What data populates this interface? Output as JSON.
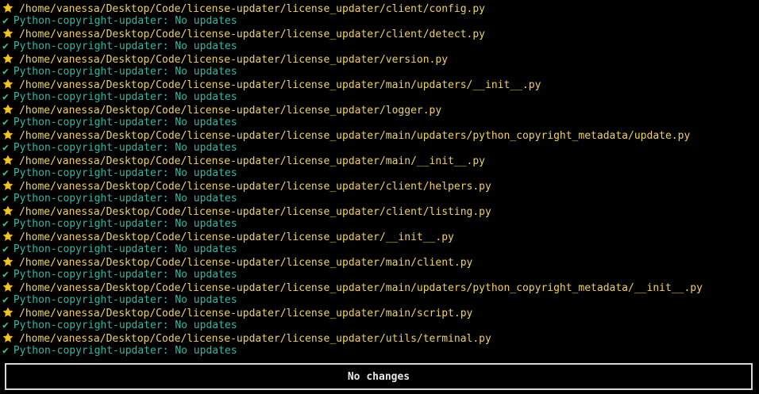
{
  "status_check_glyph": "✔",
  "entries": [
    {
      "path": "/home/vanessa/Desktop/Code/license-updater/license_updater/client/config.py",
      "status": "Python-copyright-updater: No updates"
    },
    {
      "path": "/home/vanessa/Desktop/Code/license-updater/license_updater/client/detect.py",
      "status": "Python-copyright-updater: No updates"
    },
    {
      "path": "/home/vanessa/Desktop/Code/license-updater/license_updater/version.py",
      "status": "Python-copyright-updater: No updates"
    },
    {
      "path": "/home/vanessa/Desktop/Code/license-updater/license_updater/main/updaters/__init__.py",
      "status": "Python-copyright-updater: No updates"
    },
    {
      "path": "/home/vanessa/Desktop/Code/license-updater/license_updater/logger.py",
      "status": "Python-copyright-updater: No updates"
    },
    {
      "path": "/home/vanessa/Desktop/Code/license-updater/license_updater/main/updaters/python_copyright_metadata/update.py",
      "status": "Python-copyright-updater: No updates"
    },
    {
      "path": "/home/vanessa/Desktop/Code/license-updater/license_updater/main/__init__.py",
      "status": "Python-copyright-updater: No updates"
    },
    {
      "path": "/home/vanessa/Desktop/Code/license-updater/license_updater/client/helpers.py",
      "status": "Python-copyright-updater: No updates"
    },
    {
      "path": "/home/vanessa/Desktop/Code/license-updater/license_updater/client/listing.py",
      "status": "Python-copyright-updater: No updates"
    },
    {
      "path": "/home/vanessa/Desktop/Code/license-updater/license_updater/__init__.py",
      "status": "Python-copyright-updater: No updates"
    },
    {
      "path": "/home/vanessa/Desktop/Code/license-updater/license_updater/main/client.py",
      "status": "Python-copyright-updater: No updates"
    },
    {
      "path": "/home/vanessa/Desktop/Code/license-updater/license_updater/main/updaters/python_copyright_metadata/__init__.py",
      "status": "Python-copyright-updater: No updates"
    },
    {
      "path": "/home/vanessa/Desktop/Code/license-updater/license_updater/main/script.py",
      "status": "Python-copyright-updater: No updates"
    },
    {
      "path": "/home/vanessa/Desktop/Code/license-updater/license_updater/utils/terminal.py",
      "status": "Python-copyright-updater: No updates"
    }
  ],
  "summary": {
    "label": "No changes"
  },
  "colors": {
    "background": "#000000",
    "path_text": "#f0d25c",
    "status_text": "#2eb8a6",
    "check_mark": "#39c47a",
    "star_fill": "#f5c518",
    "box_border": "#d8d8d8",
    "box_text": "#e8e8e8"
  },
  "icons": {
    "file_marker": "star-icon",
    "status_marker": "check-icon"
  }
}
